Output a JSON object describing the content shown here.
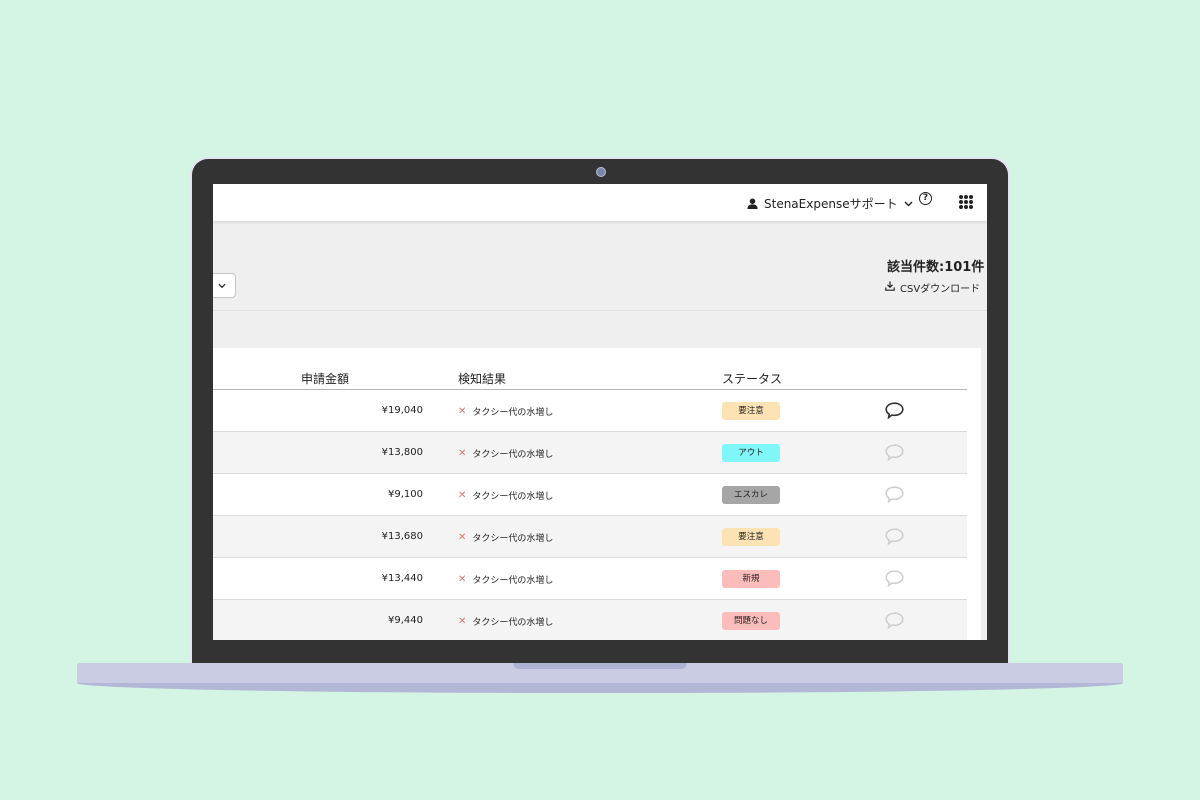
{
  "header": {
    "user_name": "StenaExpenseサポート",
    "help_symbol": "?"
  },
  "summary": {
    "count_label": "該当件数:101件",
    "csv_label": "CSVダウンロード"
  },
  "table": {
    "columns": [
      "申請金額",
      "検知結果",
      "ステータス"
    ],
    "rows": [
      {
        "amount": "¥19,040",
        "result": "タクシー代の水増し",
        "status": "要注意",
        "status_color": "#fde3b4",
        "has_comment": true
      },
      {
        "amount": "¥13,800",
        "result": "タクシー代の水増し",
        "status": "アウト",
        "status_color": "#7ff6f8",
        "has_comment": false
      },
      {
        "amount": "¥9,100",
        "result": "タクシー代の水増し",
        "status": "エスカレ",
        "status_color": "#a6a6a6",
        "has_comment": false
      },
      {
        "amount": "¥13,680",
        "result": "タクシー代の水増し",
        "status": "要注意",
        "status_color": "#fde3b4",
        "has_comment": false
      },
      {
        "amount": "¥13,440",
        "result": "タクシー代の水増し",
        "status": "新規",
        "status_color": "#fdbcbc",
        "has_comment": false
      },
      {
        "amount": "¥9,440",
        "result": "タクシー代の水増し",
        "status": "問題なし",
        "status_color": "#fdbcbc",
        "has_comment": false
      }
    ]
  },
  "colors": {
    "background": "#d4f5e4",
    "bezel": "#333333",
    "laptop_base": "#c9cce2"
  }
}
